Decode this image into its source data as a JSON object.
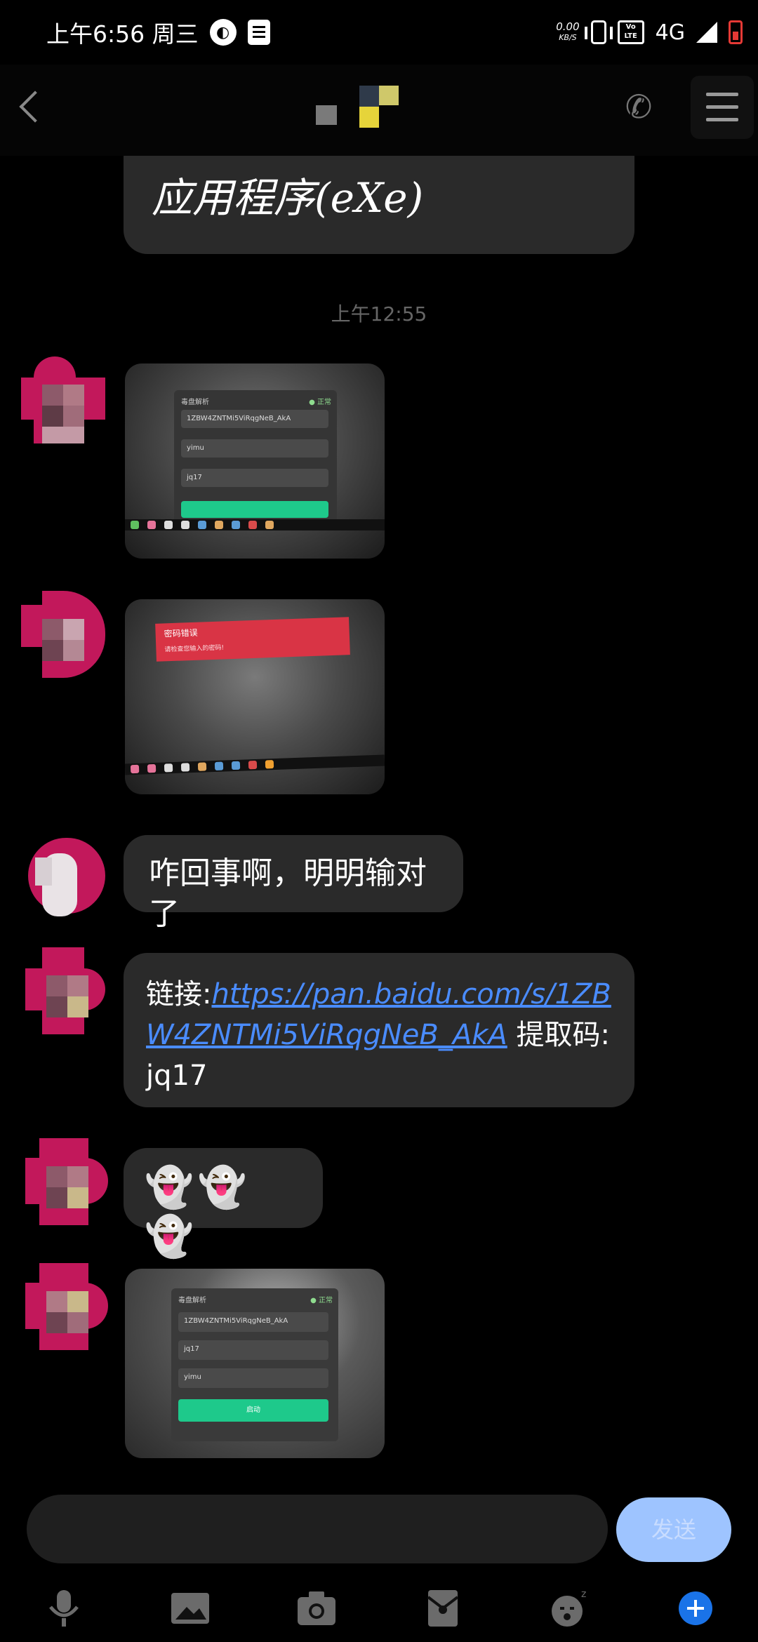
{
  "status_bar": {
    "time": "上午6:56 周三",
    "net_speed_value": "0.00",
    "net_speed_unit": "KB/S",
    "volte_line1": "Vo",
    "volte_line2": "LTE",
    "network": "4G"
  },
  "header": {
    "icons": {
      "back": "back-icon",
      "phone": "phone-icon",
      "menu": "menu-icon"
    }
  },
  "messages": {
    "top_partial_text": "应用程序(eXe)",
    "timestamp": "上午12:55",
    "photo1": {
      "window_title": "毒盘解析",
      "status": "● 正常",
      "field1": "1ZBW4ZNTMi5ViRqgNeB_AkA",
      "field2": "yimu",
      "field3": "jq17"
    },
    "photo2": {
      "error_title": "密码错误",
      "error_detail": "请检查您输入的密码!"
    },
    "text1": "咋回事啊，明明输对了",
    "link_msg": {
      "prefix": "链接:",
      "url": "https://pan.baidu.com/s/1ZBW4ZNTMi5ViRqgNeB_AkA",
      "suffix": " 提取码:jq17"
    },
    "emoji": "👻👻👻",
    "photo3": {
      "window_title": "毒盘解析",
      "status": "● 正常",
      "field1": "1ZBW4ZNTMi5ViRqgNeB_AkA",
      "field2": "jq17",
      "field3": "yimu",
      "button": "启动"
    }
  },
  "input_bar": {
    "send_label": "发送"
  },
  "toolbar": {
    "icons": [
      "microphone-icon",
      "image-icon",
      "camera-icon",
      "red-packet-icon",
      "emoji-icon",
      "plus-icon"
    ]
  },
  "colors": {
    "bubble": "#2a2a2a",
    "link": "#4a8cff",
    "send_button": "#9ec4ff",
    "accent_blue": "#1a73e8"
  }
}
